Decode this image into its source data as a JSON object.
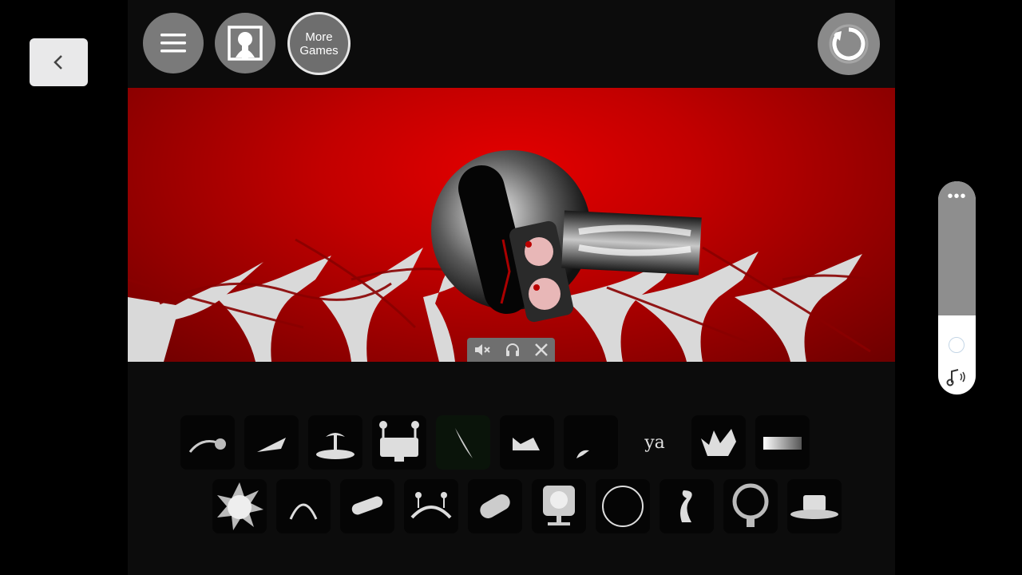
{
  "nav": {
    "back_icon": "chevron-left-icon"
  },
  "header": {
    "menu_icon": "hamburger-icon",
    "gallery_icon": "portrait-frame-icon",
    "more_games_line1": "More",
    "more_games_line2": "Games",
    "reset_icon": "refresh-icon"
  },
  "media_bar": {
    "icons": [
      "mute-icon",
      "headphones-icon",
      "close-icon"
    ]
  },
  "tray": {
    "row1": [
      "hook-icon",
      "wedge-icon",
      "palm-island-icon",
      "monitor-antenna-icon",
      "blade-icon",
      "cat-ears-icon",
      "small-horn-icon",
      "ya",
      "crown-icon",
      "gradient-bar-icon"
    ],
    "row2": [
      "spiky-sun-icon",
      "arc-icon",
      "striped-capsule-icon",
      "antenna-headband-icon",
      "bandage-icon",
      "screen-stand-icon",
      "ring-icon",
      "wave-curl-icon",
      "medal-ring-icon",
      "top-hat-icon"
    ]
  },
  "volume": {
    "level": 0.37,
    "menu_icon": "dots-icon",
    "sound_icon": "music-note-icon"
  },
  "colors": {
    "stage_red": "#d00000",
    "tray_bg": "#050505",
    "button_gray": "#7a7a7a"
  }
}
